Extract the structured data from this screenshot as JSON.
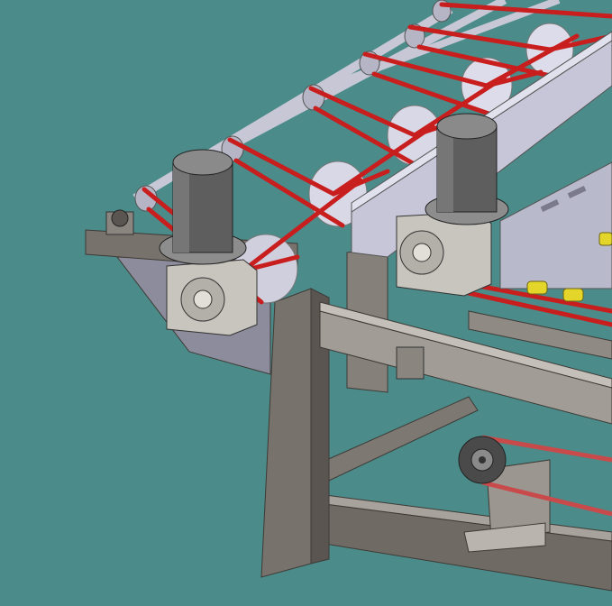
{
  "scene": {
    "background": "#4b8b89",
    "colors": {
      "frame_dark": "#5f5a55",
      "frame_mid": "#8a857f",
      "frame_light": "#b5b0a9",
      "motor_dark": "#3f3f3f",
      "motor_mid": "#6b6b6b",
      "motor_light": "#9a9a9a",
      "roller": "#d9d9e6",
      "roller_shade": "#b0b0c4",
      "belt": "#cc1f1f",
      "belt_dark": "#8a1111",
      "beam": "#c9c9da",
      "beam_shade": "#9d9db2",
      "accent_yellow": "#e3d52a"
    },
    "components": [
      "left-drive-motor",
      "right-drive-motor",
      "roller-conveyor",
      "red-drive-belts",
      "support-frame",
      "lower-pulley"
    ]
  }
}
